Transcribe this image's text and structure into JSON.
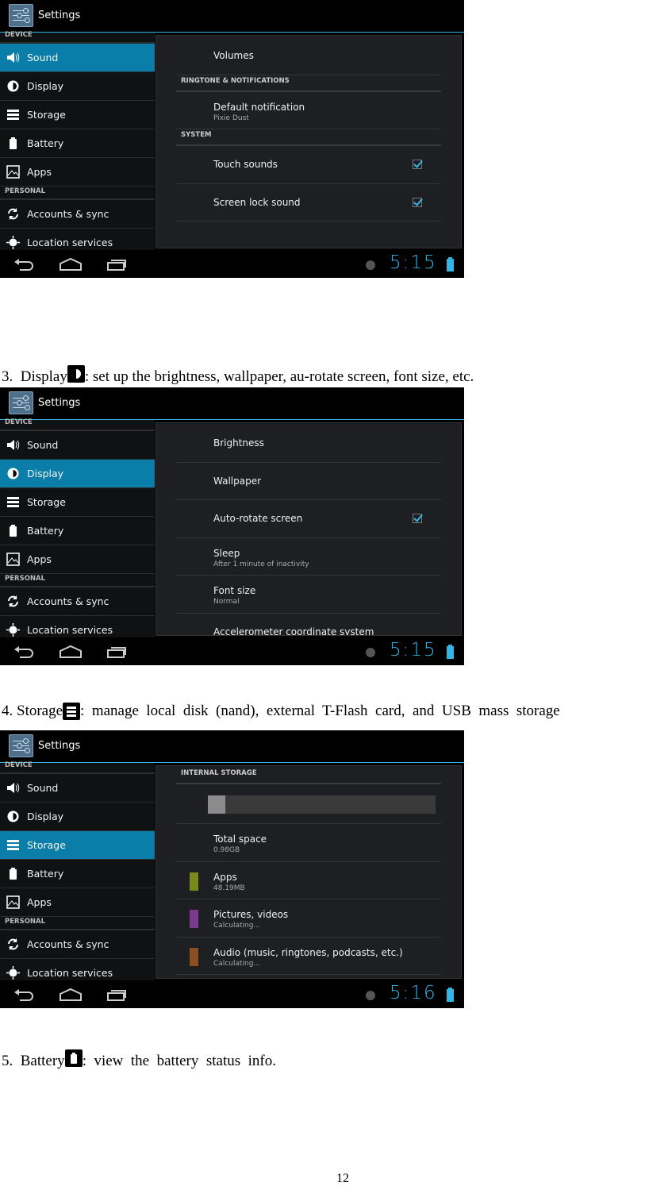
{
  "doc": {
    "para3": {
      "number": "3.",
      "title": "Display",
      "icon": "display-brightness-icon",
      "text": ": set up the brightness, wallpaper, au-rotate screen, font size, etc."
    },
    "para4": {
      "number": "4.",
      "title": "Storage",
      "icon": "storage-icon",
      "text": ":  manage  local  disk  (nand),  external  T-Flash  card,  and  USB  mass  storage"
    },
    "para5": {
      "number": "5.",
      "title": "Battery",
      "icon": "battery-icon",
      "text": ":  view  the  battery  status  info."
    },
    "page_number": "12"
  },
  "colors": {
    "accent": "#33b5e5",
    "selected": "#0a7ea8",
    "apps": "#7a8a1a",
    "pictures": "#7b3a8c",
    "audio": "#8c4f22"
  },
  "screenshots": [
    {
      "app_title": "Settings",
      "selected": 0,
      "sidebar": {
        "sections": [
          "DEVICE",
          "PERSONAL"
        ],
        "items": [
          {
            "label": "Sound",
            "icon": "speaker-icon"
          },
          {
            "label": "Display",
            "icon": "brightness-icon"
          },
          {
            "label": "Storage",
            "icon": "storage-icon"
          },
          {
            "label": "Battery",
            "icon": "battery-icon"
          },
          {
            "label": "Apps",
            "icon": "apps-icon"
          },
          {
            "label": "Accounts & sync",
            "icon": "sync-icon"
          },
          {
            "label": "Location services",
            "icon": "location-icon"
          }
        ]
      },
      "panel": [
        {
          "type": "item",
          "title": "Volumes"
        },
        {
          "type": "header",
          "title": "RINGTONE & NOTIFICATIONS"
        },
        {
          "type": "item",
          "title": "Default notification",
          "summary": "Pixie Dust"
        },
        {
          "type": "header",
          "title": "SYSTEM"
        },
        {
          "type": "item",
          "title": "Touch sounds",
          "checked": true
        },
        {
          "type": "item",
          "title": "Screen lock sound",
          "checked": true
        }
      ],
      "clock": "5:15"
    },
    {
      "app_title": "Settings",
      "selected": 1,
      "sidebar": {
        "sections": [
          "DEVICE",
          "PERSONAL"
        ],
        "items": [
          {
            "label": "Sound",
            "icon": "speaker-icon"
          },
          {
            "label": "Display",
            "icon": "brightness-icon"
          },
          {
            "label": "Storage",
            "icon": "storage-icon"
          },
          {
            "label": "Battery",
            "icon": "battery-icon"
          },
          {
            "label": "Apps",
            "icon": "apps-icon"
          },
          {
            "label": "Accounts & sync",
            "icon": "sync-icon"
          },
          {
            "label": "Location services",
            "icon": "location-icon"
          }
        ]
      },
      "panel": [
        {
          "type": "item",
          "title": "Brightness"
        },
        {
          "type": "item",
          "title": "Wallpaper"
        },
        {
          "type": "item",
          "title": "Auto-rotate screen",
          "checked": true
        },
        {
          "type": "item",
          "title": "Sleep",
          "summary": "After 1 minute of inactivity"
        },
        {
          "type": "item",
          "title": "Font size",
          "summary": "Normal"
        },
        {
          "type": "item",
          "title": "Accelerometer coordinate system"
        }
      ],
      "clock": "5:15"
    },
    {
      "app_title": "Settings",
      "selected": 2,
      "sidebar": {
        "sections": [
          "DEVICE",
          "PERSONAL"
        ],
        "items": [
          {
            "label": "Sound",
            "icon": "speaker-icon"
          },
          {
            "label": "Display",
            "icon": "brightness-icon"
          },
          {
            "label": "Storage",
            "icon": "storage-icon"
          },
          {
            "label": "Battery",
            "icon": "battery-icon"
          },
          {
            "label": "Apps",
            "icon": "apps-icon"
          },
          {
            "label": "Accounts & sync",
            "icon": "sync-icon"
          },
          {
            "label": "Location services",
            "icon": "location-icon"
          }
        ]
      },
      "panel": [
        {
          "type": "header",
          "title": "INTERNAL STORAGE"
        },
        {
          "type": "bar",
          "used_fraction": 0.077
        },
        {
          "type": "item",
          "title": "Total space",
          "summary": "0.98GB"
        },
        {
          "type": "item",
          "title": "Apps",
          "summary": "48.19MB",
          "swatch": "#7a8a1a"
        },
        {
          "type": "item",
          "title": "Pictures, videos",
          "summary": "Calculating...",
          "swatch": "#7b3a8c"
        },
        {
          "type": "item",
          "title": "Audio (music, ringtones, podcasts, etc.)",
          "summary": "Calculating...",
          "swatch": "#8c4f22"
        }
      ],
      "clock": "5:16"
    }
  ]
}
